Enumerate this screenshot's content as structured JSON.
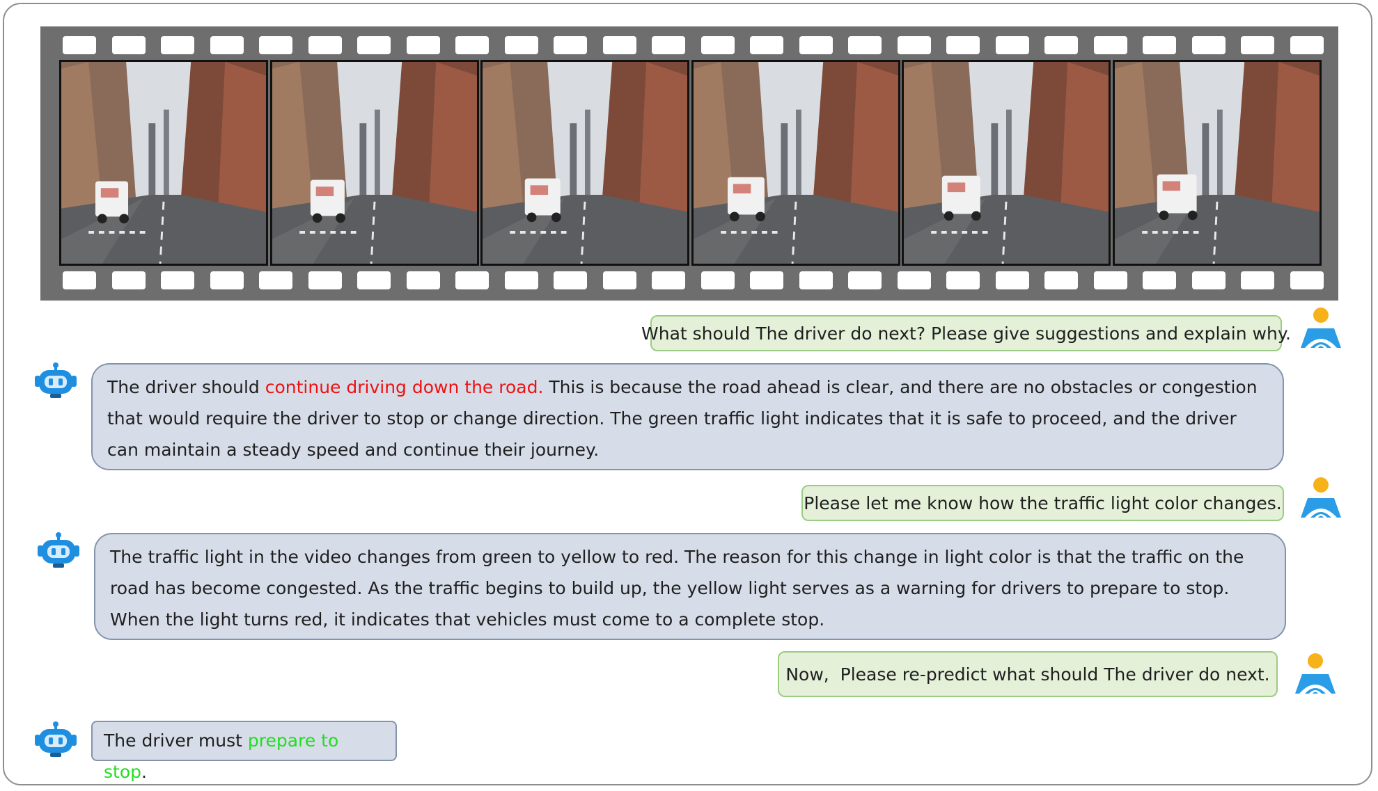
{
  "film_strip": {
    "frame_count": 6,
    "frame_description": "street-view driving frames"
  },
  "conversation": {
    "user1": {
      "text": "What should The driver do next? Please give suggestions and explain why."
    },
    "bot1": {
      "prefix": "The driver should ",
      "highlight": "continue driving down the road.",
      "suffix": " This is because the road ahead is clear, and there are no obstacles or congestion that would require the driver to stop or change direction. The green traffic light indicates that it is safe to proceed, and the driver can maintain a steady speed and continue their journey."
    },
    "user2": {
      "text": "Please let me know how the traffic light color changes."
    },
    "bot2": {
      "text": "The traffic light in the video changes from green to yellow to red. The reason for this change in light color is that the traffic on the road has become congested. As the traffic begins to build up, the yellow light serves as a warning for drivers to prepare to stop. When the light turns red, it indicates that vehicles must come to a complete stop."
    },
    "user3": {
      "text": "Now,  Please re-predict what should The driver do next."
    },
    "bot3": {
      "prefix": "The driver must ",
      "highlight": "prepare to stop",
      "suffix": "."
    }
  },
  "colors": {
    "user_bubble_bg": "#e4f1d8",
    "user_bubble_border": "#9ccc84",
    "bot_bubble_bg": "#d7dde8",
    "bot_bubble_border": "#8393ad",
    "highlight_red": "#ee1111",
    "highlight_green": "#22dd22",
    "robot_icon": "#1e8fe0",
    "user_icon_head": "#f7b21a",
    "user_icon_body": "#2a9de6"
  }
}
